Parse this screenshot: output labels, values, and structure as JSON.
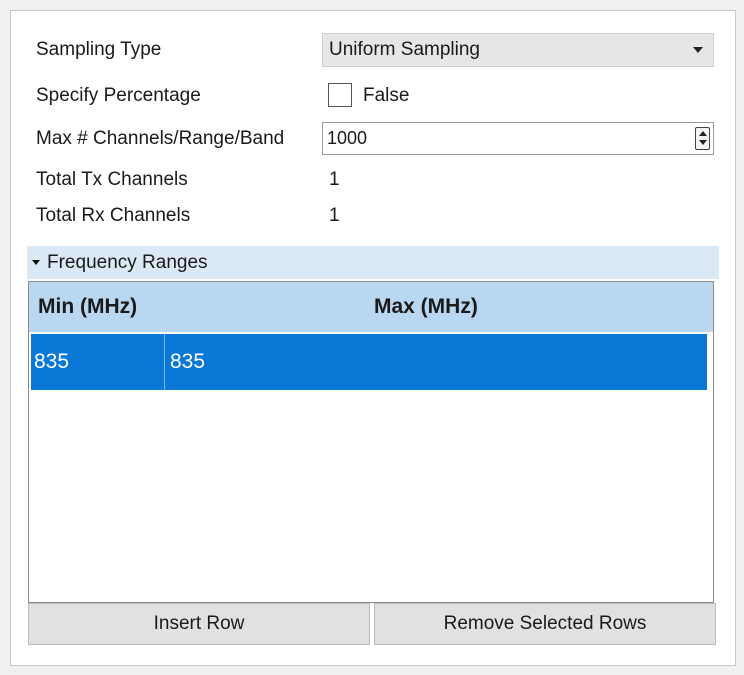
{
  "form": {
    "sampling_type_label": "Sampling Type",
    "sampling_type_value": "Uniform Sampling",
    "specify_percentage_label": "Specify Percentage",
    "specify_percentage_value": "False",
    "max_channels_label": "Max # Channels/Range/Band",
    "max_channels_value": "1000",
    "total_tx_label": "Total Tx Channels",
    "total_tx_value": "1",
    "total_rx_label": "Total Rx Channels",
    "total_rx_value": "1"
  },
  "frequency_ranges": {
    "title": "Frequency Ranges",
    "columns": [
      "Min (MHz)",
      "Max (MHz)"
    ],
    "rows": [
      [
        "835",
        "835"
      ]
    ],
    "selected_row_color": "#0b78d7"
  },
  "buttons": {
    "insert_row": "Insert Row",
    "remove_selected_rows": "Remove Selected Rows"
  },
  "icons": {
    "combo_arrow": "chevron-down-icon",
    "section_toggle": "triangle-down-icon",
    "spin": "spinner-icon"
  }
}
